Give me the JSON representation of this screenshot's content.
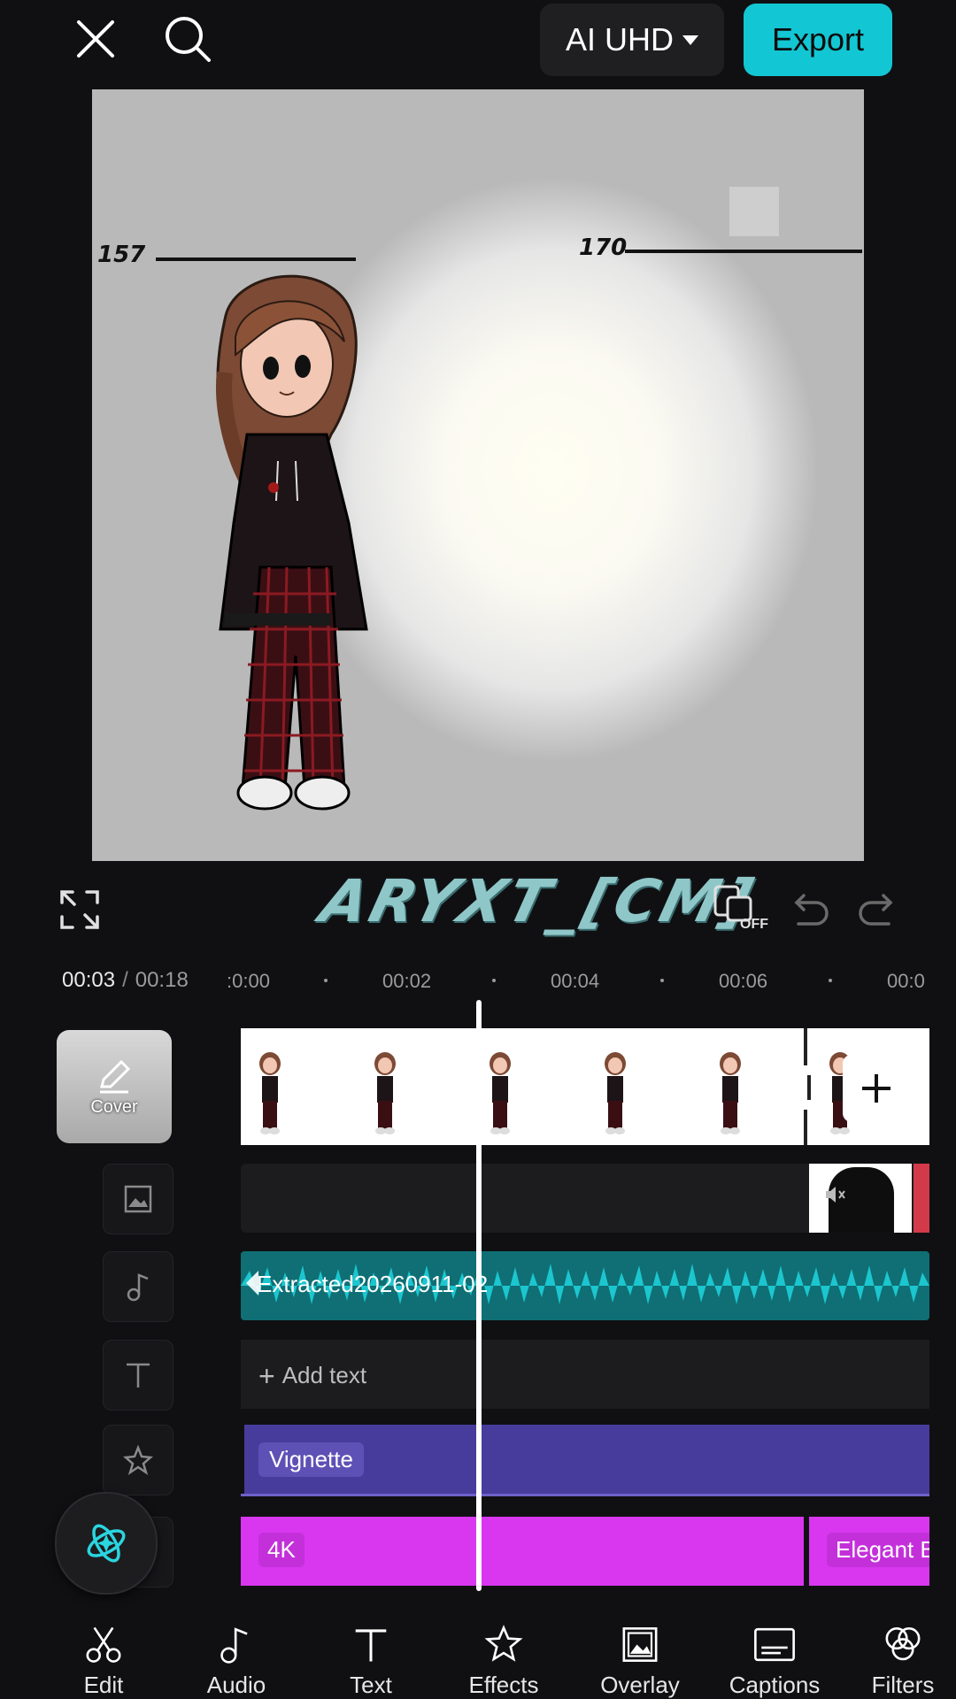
{
  "top_bar": {
    "quality_label": "AI UHD",
    "export_label": "Export"
  },
  "preview": {
    "label_left": "157",
    "label_right": "170"
  },
  "controls": {
    "mirror_off_label": "OFF",
    "watermark_text": "ARYXT_[CM]"
  },
  "timeline": {
    "current_time": "00:03",
    "separator": "/",
    "total_time": "00:18",
    "ruler_labels": [
      ":0:00",
      "00:02",
      "00:04",
      "00:06",
      "00:0"
    ],
    "cover_label": "Cover",
    "audio_clip_name": "Extracted20260911-02",
    "add_text_label": "Add text",
    "effect_name": "Vignette",
    "filter_name": "4K",
    "filter_name_2": "Elegant B"
  },
  "toolbar": {
    "items": [
      {
        "label": "Edit",
        "icon": "scissors-icon"
      },
      {
        "label": "Audio",
        "icon": "music-note-icon"
      },
      {
        "label": "Text",
        "icon": "text-icon"
      },
      {
        "label": "Effects",
        "icon": "star-effects-icon"
      },
      {
        "label": "Overlay",
        "icon": "overlay-icon"
      },
      {
        "label": "Captions",
        "icon": "captions-icon"
      },
      {
        "label": "Filters",
        "icon": "filters-icon"
      }
    ]
  },
  "colors": {
    "accent": "#13c6d3",
    "audio_track": "#0f6f74",
    "effect_track": "#473c9c",
    "filter_track": "#d837ef"
  }
}
